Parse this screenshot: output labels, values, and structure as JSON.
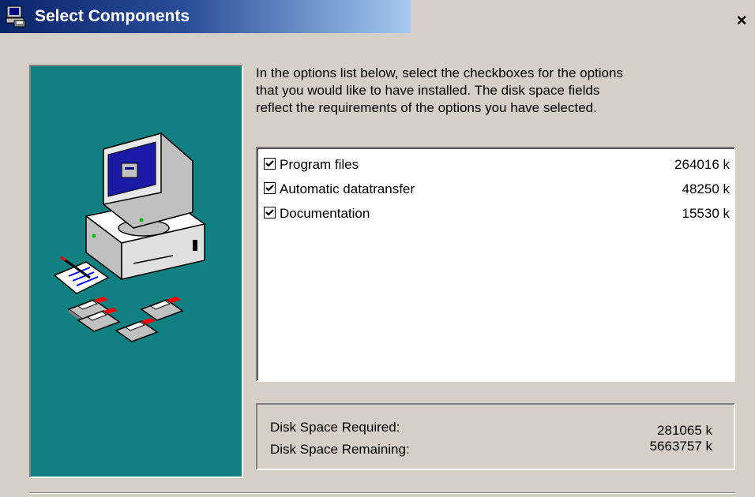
{
  "window": {
    "title": "Select Components",
    "close_glyph": "×"
  },
  "instructions": {
    "line1": "In the options list below, select the checkboxes for the options",
    "line2": "that you would like to have installed.  The disk space fields",
    "line3": "reflect the requirements of the options you have selected."
  },
  "components": [
    {
      "label": "Program files",
      "size": "264016 k",
      "checked": true
    },
    {
      "label": "Automatic datatransfer",
      "size": "48250 k",
      "checked": true
    },
    {
      "label": "Documentation",
      "size": "15530 k",
      "checked": true
    }
  ],
  "disk_space": {
    "required_label": "Disk Space Required:",
    "required_value": "281065 k",
    "remaining_label": "Disk Space Remaining:",
    "remaining_value": "5663757 k"
  },
  "colors": {
    "title_bar": "#0a246a",
    "panel_teal": "#108080",
    "dialog_face": "#d4d0c8"
  },
  "icons": {
    "app": "installer-icon",
    "illustration": "computer-with-floppy-disks-illustration",
    "close": "close-icon"
  }
}
